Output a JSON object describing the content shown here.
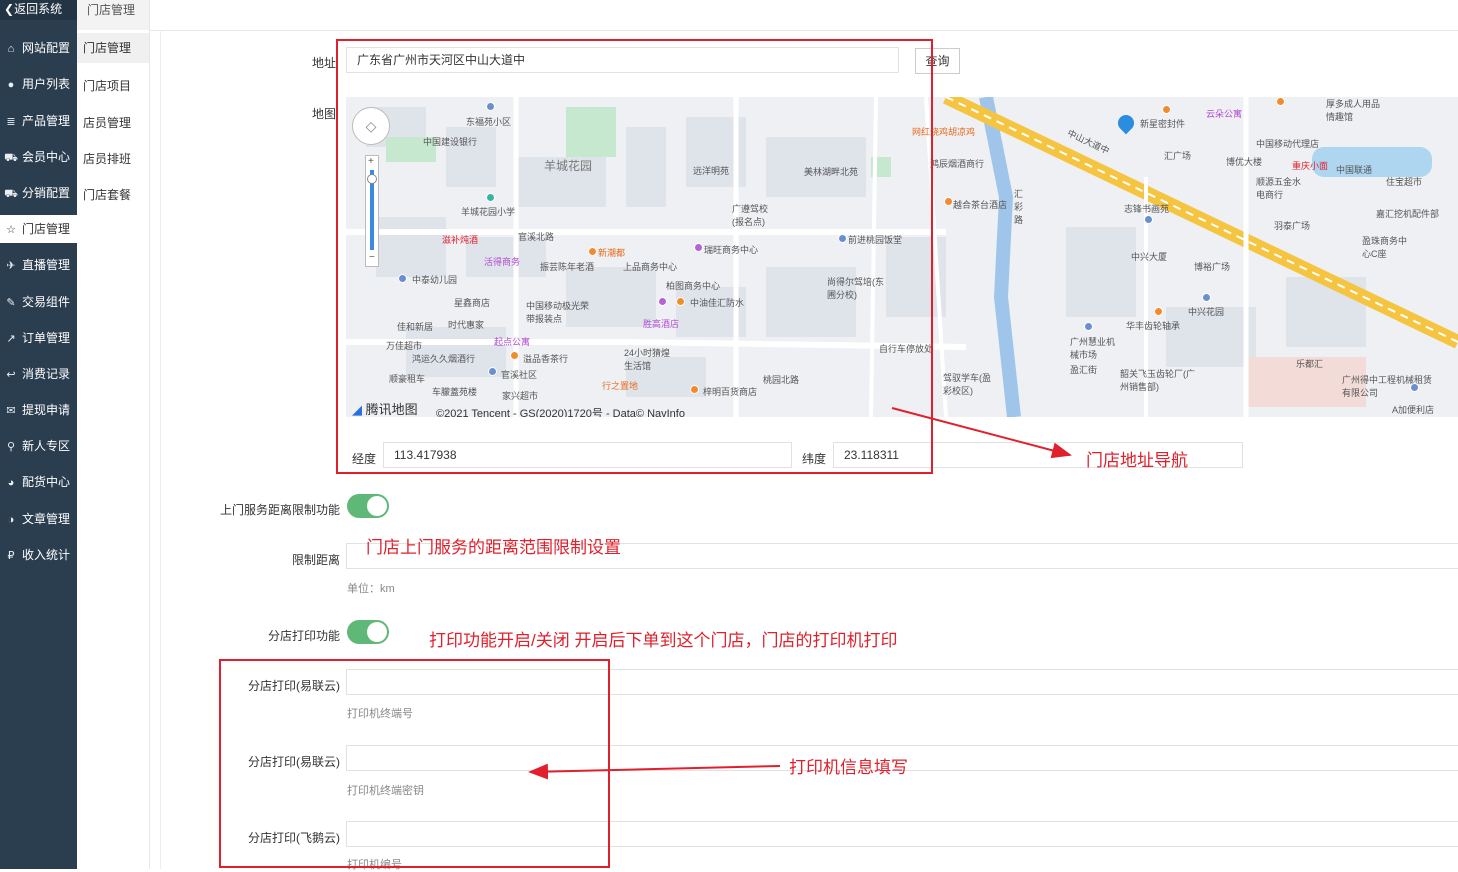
{
  "sidebar": {
    "back_label": "返回系统",
    "items": [
      {
        "label": "网站配置",
        "icon": "home-icon"
      },
      {
        "label": "用户列表",
        "icon": "user-icon"
      },
      {
        "label": "产品管理",
        "icon": "list-icon"
      },
      {
        "label": "会员中心",
        "icon": "cart-icon"
      },
      {
        "label": "分销配置",
        "icon": "cart-icon"
      },
      {
        "label": "门店管理",
        "icon": "star-icon"
      },
      {
        "label": "直播管理",
        "icon": "plane-icon"
      },
      {
        "label": "交易组件",
        "icon": "edit-icon"
      },
      {
        "label": "订单管理",
        "icon": "share-icon"
      },
      {
        "label": "消费记录",
        "icon": "reply-icon"
      },
      {
        "label": "提现申请",
        "icon": "chat-icon"
      },
      {
        "label": "新人专区",
        "icon": "location-icon"
      },
      {
        "label": "配货中心",
        "icon": "pie-icon"
      },
      {
        "label": "文章管理",
        "icon": "half-circle-icon"
      },
      {
        "label": "收入统计",
        "icon": "coin-icon"
      }
    ]
  },
  "submenu": {
    "header": "门店管理",
    "items": [
      "门店管理",
      "门店项目",
      "店员管理",
      "店员排班",
      "门店套餐"
    ]
  },
  "form": {
    "address_label": "地址",
    "address_value": "广东省广州市天河区中山大道中",
    "query_button": "查询",
    "map_label": "地图",
    "longitude_label": "经度",
    "longitude_value": "113.417938",
    "latitude_label": "纬度",
    "latitude_value": "23.118311",
    "home_service_label": "上门服务距离限制功能",
    "limit_distance_label": "限制距离",
    "limit_distance_help": "单位：km",
    "branch_print_label": "分店打印功能",
    "print1_label": "分店打印(易联云)",
    "print1_help": "打印机终端号",
    "print2_label": "分店打印(易联云)",
    "print2_help": "打印机终端密钥",
    "print3_label": "分店打印(飞鹅云)",
    "print3_help": "打印机编号"
  },
  "map": {
    "brand": "腾讯地图",
    "copyright": "©2021 Tencent - GS(2020)1720号 - Data© NavInfo",
    "labels": [
      "东福苑小区",
      "中国建设银行",
      "羊城花园",
      "远洋明苑",
      "美林湖畔北苑",
      "广遵驾校(报名点)",
      "羊城花园小学",
      "滋补炖酒",
      "活得商务",
      "官溪北路",
      "新潮都",
      "瑞旺商务中心",
      "前进桃园饭堂",
      "振芸陈年老酒",
      "上品商务中心",
      "柏图商务中心",
      "尚得尔驾培(东圃分校)",
      "中泰幼儿园",
      "星鑫商店",
      "中国移动极光荣带报装点",
      "中油佳汇防水",
      "佳和新居",
      "时代惠家",
      "起点公寓",
      "胜高酒店",
      "万佳超市",
      "24小时猜煌生活馆",
      "自行车停放处",
      "鸿运久久烟酒行",
      "溢品香茶行",
      "顺豪租车",
      "官溪社区",
      "行之置地",
      "车朦蓋苑楼",
      "家兴超市",
      "梓明百货商店",
      "桃园北路",
      "新星密封件",
      "云朵公寓",
      "厚多成人用品情趣馆",
      "中国移动代理店",
      "汇广场",
      "博优大楼",
      "重庆小面",
      "中国联通",
      "顺源五金水电商行",
      "住宝超市",
      "越合茶台酒店",
      "志锋书画苑",
      "羽泰广场",
      "嘉汇挖机配件部",
      "中兴大厦",
      "博裕广场",
      "盈珠商务中心C座",
      "中兴花园",
      "华丰齿轮轴承",
      "广州慧业机械市场",
      "盈汇街",
      "韶关飞玉齿轮厂(广州销售部)",
      "乐都汇",
      "广州得中工程机械租赁有限公司",
      "A加便利店",
      "驾驭学车(盈彩校区)",
      "中山大道中",
      "网红烧鸡胡凉鸡",
      "鸿辰烟酒商行",
      "汇彩路"
    ]
  },
  "annotations": {
    "store_nav": "门店地址导航",
    "service_range": "门店上门服务的距离范围限制设置",
    "print_toggle": "打印功能开启/关闭   开启后下单到这个门店，门店的打印机打印",
    "printer_info": "打印机信息填写"
  },
  "colors": {
    "sidebar_bg": "#2b3e50",
    "switch_on": "#5fb878",
    "annotation_red": "#e0202d"
  }
}
